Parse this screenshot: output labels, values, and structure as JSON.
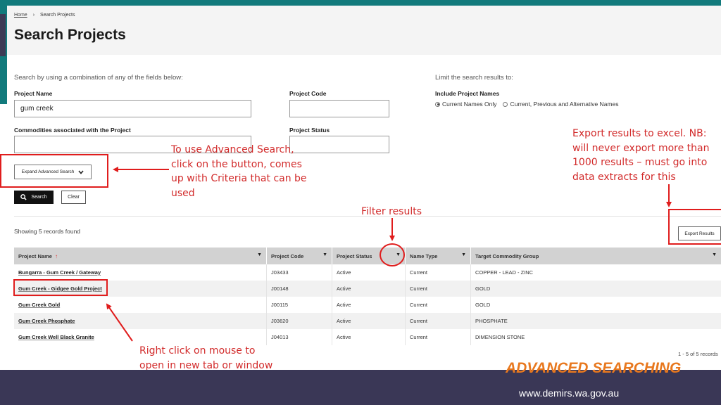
{
  "colors": {
    "accent_red": "#e01d1d",
    "annotation_red": "#d22b2b",
    "teal": "#127a7c",
    "footer": "#3a3756",
    "title_orange": "#e8781e"
  },
  "breadcrumb": {
    "home": "Home",
    "current": "Search Projects"
  },
  "page_title": "Search Projects",
  "hint": "Search by using a combination of any of the fields below:",
  "limit": {
    "label": "Limit the search results to:",
    "include_label": "Include Project Names",
    "options": [
      "Current Names Only",
      "Current, Previous and Alternative Names"
    ],
    "selected": "Current Names Only"
  },
  "fields": {
    "project_name_label": "Project Name",
    "project_name_value": "gum creek",
    "project_code_label": "Project Code",
    "project_code_value": "",
    "commodities_label": "Commodities associated with the Project",
    "commodities_value": "",
    "project_status_label": "Project Status",
    "project_status_value": ""
  },
  "buttons": {
    "expand_advanced": "Expand Advanced Search",
    "search": "Search",
    "clear": "Clear",
    "export": "Export Results"
  },
  "results": {
    "summary": "Showing 5 records found",
    "page_count": "1 - 5 of 5 records",
    "columns": [
      "Project Name",
      "Project Code",
      "Project Status",
      "Name Type",
      "Target Commodity Group"
    ],
    "rows": [
      [
        "Bungarra - Gum Creek / Gateway",
        "J03433",
        "Active",
        "Current",
        "COPPER - LEAD - ZINC"
      ],
      [
        "Gum Creek - Gidgee Gold Project",
        "J00148",
        "Active",
        "Current",
        "GOLD"
      ],
      [
        "Gum Creek Gold",
        "J00115",
        "Active",
        "Current",
        "GOLD"
      ],
      [
        "Gum Creek Phosphate",
        "J03620",
        "Active",
        "Current",
        "PHOSPHATE"
      ],
      [
        "Gum Creek Well Black Granite",
        "J04013",
        "Active",
        "Current",
        "DIMENSION STONE"
      ]
    ]
  },
  "annotations": {
    "advanced": [
      "To use Advanced Search,",
      "click on the button, comes",
      "up with Criteria that can be",
      "used"
    ],
    "export": [
      "Export results to excel. NB:",
      "will never export more than",
      "1000 results – must go into",
      "data extracts for this"
    ],
    "filter": "Filter results",
    "rightclick": [
      "Right click on mouse to",
      "open in new tab or window"
    ]
  },
  "slide": {
    "title": "ADVANCED SEARCHING",
    "url": "www.demirs.wa.gov.au"
  }
}
